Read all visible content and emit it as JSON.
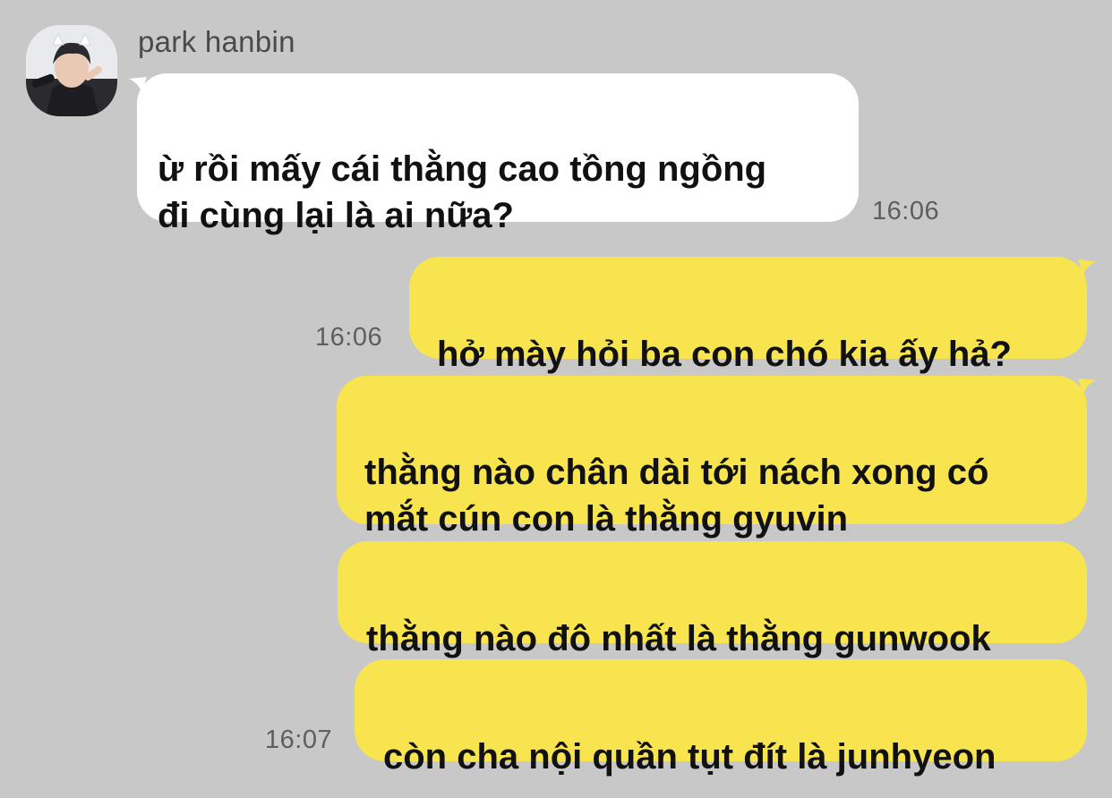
{
  "contact": {
    "name": "park hanbin",
    "avatar_icon": "profile-photo"
  },
  "colors": {
    "background": "#c8c8c8",
    "incoming_bubble": "#ffffff",
    "outgoing_bubble": "#f8e44f",
    "timestamp": "#5e5e5e"
  },
  "messages": [
    {
      "direction": "incoming",
      "text": "ừ rồi mấy cái thằng cao tồng ngồng\nđi cùng lại là ai nữa?",
      "time": "16:06"
    },
    {
      "direction": "outgoing",
      "text": "hở mày hỏi ba con chó kia ấy hả?",
      "time": "16:06"
    },
    {
      "direction": "outgoing",
      "text": "thằng nào chân dài tới nách xong có\nmắt cún con là thằng gyuvin"
    },
    {
      "direction": "outgoing",
      "text": "thằng nào đô nhất là thằng gunwook"
    },
    {
      "direction": "outgoing",
      "text": "còn cha nội quần tụt đít là junhyeon",
      "time": "16:07"
    }
  ]
}
